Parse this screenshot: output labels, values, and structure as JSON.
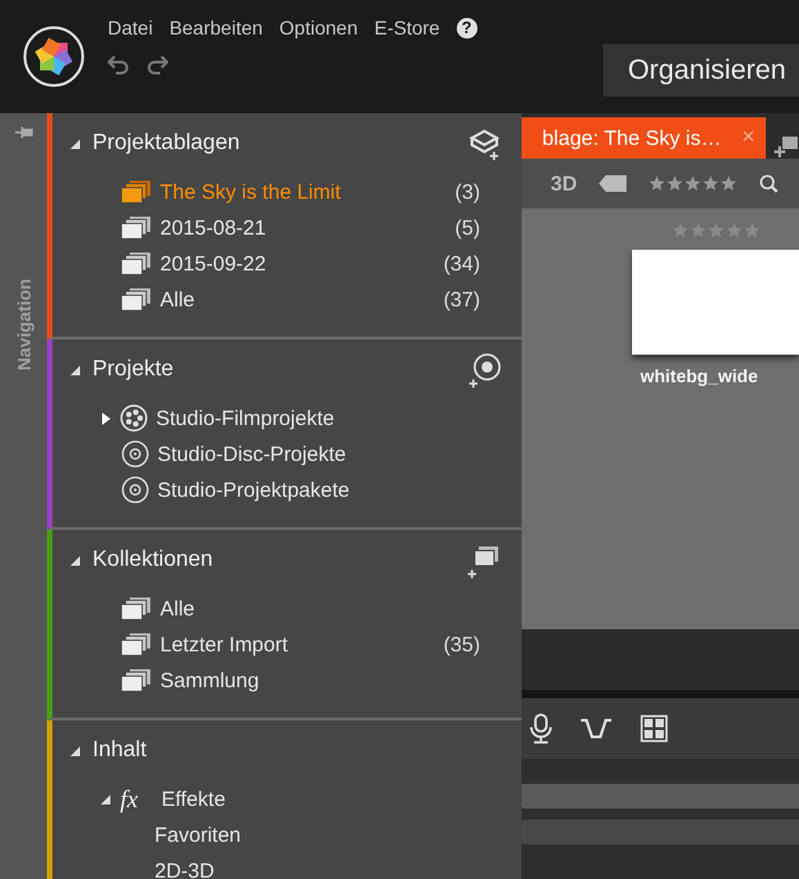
{
  "menu": [
    "Datei",
    "Bearbeiten",
    "Optionen",
    "E-Store",
    "?"
  ],
  "mode_button": "Organisieren",
  "sidebar_label": "Navigation",
  "tab": {
    "label": "blage: The Sky is…",
    "close": "×",
    "selected": true
  },
  "toolbar": {
    "view_3d": "3D",
    "stars": 0
  },
  "library": [
    {
      "name": "whitebg_wide",
      "stars": 0
    }
  ],
  "nav_sections": [
    {
      "title": "Projektablagen",
      "color": "#e84e1b",
      "expanded": true,
      "items": [
        {
          "label": "The Sky is the Limit",
          "count": "(3)",
          "selected": true,
          "kind": "folder"
        },
        {
          "label": "2015-08-21",
          "count": "(5)",
          "selected": false,
          "kind": "folder"
        },
        {
          "label": "2015-09-22",
          "count": "(34)",
          "selected": false,
          "kind": "folder"
        },
        {
          "label": "Alle",
          "count": "(37)",
          "selected": false,
          "kind": "folder"
        }
      ]
    },
    {
      "title": "Projekte",
      "color": "#9b3fc9",
      "expanded": true,
      "items": [
        {
          "label": "Studio-Filmprojekte",
          "selected": false,
          "kind": "reel",
          "expanded": false
        },
        {
          "label": "Studio-Disc-Projekte",
          "selected": false,
          "kind": "disc"
        },
        {
          "label": "Studio-Projektpakete",
          "selected": false,
          "kind": "disc"
        }
      ]
    },
    {
      "title": "Kollektionen",
      "color": "#4a9e12",
      "expanded": true,
      "items": [
        {
          "label": "Alle",
          "selected": false,
          "kind": "folder"
        },
        {
          "label": "Letzter Import",
          "count": "(35)",
          "selected": false,
          "kind": "folder"
        },
        {
          "label": "Sammlung",
          "selected": false,
          "kind": "folder"
        }
      ]
    },
    {
      "title": "Inhalt",
      "color": "#d4a300",
      "expanded": true,
      "items": [
        {
          "label": "Effekte",
          "selected": false,
          "kind": "fx",
          "symbol": "fx",
          "expanded": true,
          "children": [
            {
              "label": "Favoriten",
              "selected": false
            },
            {
              "label": "2D-3D",
              "selected": false
            }
          ]
        }
      ]
    }
  ]
}
